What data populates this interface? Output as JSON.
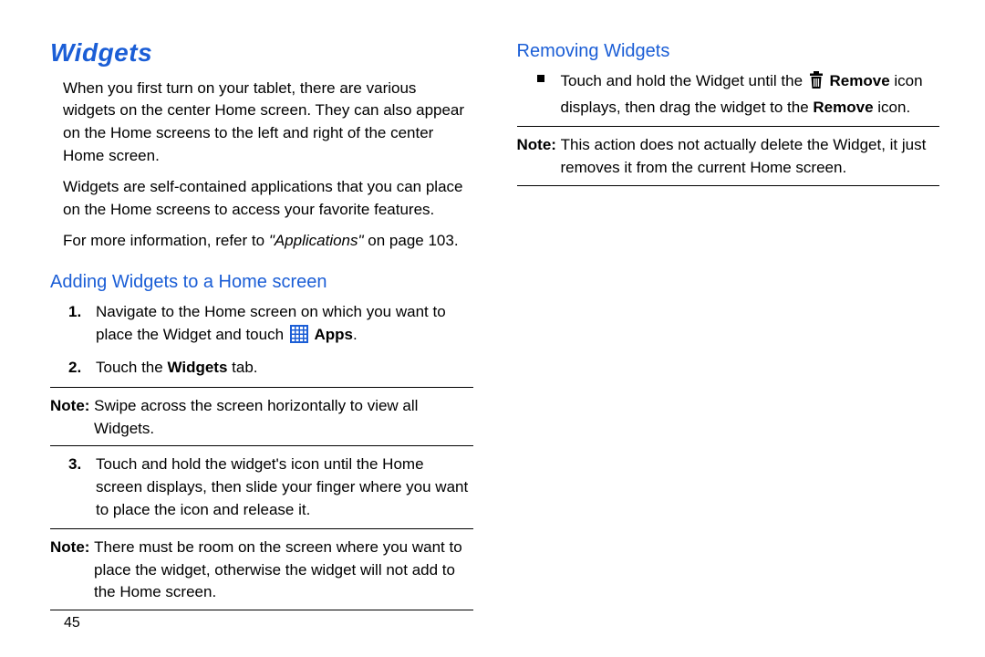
{
  "page_number": "45",
  "left": {
    "title": "Widgets",
    "intro_p1": "When you first turn on your tablet, there are various widgets on the center Home screen. They can also appear on the Home screens to the left and right of the center Home screen.",
    "intro_p2": "Widgets are self-contained applications that you can place on the Home screens to access your favorite features.",
    "ref_prefix": "For more information, refer to ",
    "ref_italic": "\"Applications\"",
    "ref_suffix": " on page 103.",
    "sub1": "Adding Widgets to a Home screen",
    "step1_num": "1.",
    "step1_a": "Navigate to the Home screen on which you want to place the Widget and touch ",
    "step1_b_bold": "Apps",
    "step1_c": ".",
    "step2_num": "2.",
    "step2_a": "Touch the ",
    "step2_b_bold": "Widgets",
    "step2_c": " tab.",
    "note1_label": "Note: ",
    "note1_body": "Swipe across the screen horizontally to view all Widgets.",
    "step3_num": "3.",
    "step3": "Touch and hold the widget's icon until the Home screen displays, then slide your finger where you want to place the icon and release it.",
    "note2_label": "Note: ",
    "note2_body": "There must be room on the screen where you want to place the widget, otherwise the widget will not add to the Home screen."
  },
  "right": {
    "sub": "Removing Widgets",
    "bullet_a": "Touch and hold the Widget until the ",
    "bullet_b_bold": "Remove",
    "bullet_c": " icon displays, then drag the widget to the ",
    "bullet_d_bold": "Remove",
    "bullet_e": " icon.",
    "note_label": "Note: ",
    "note_body": "This action does not actually delete the Widget, it just removes it from the current Home screen."
  }
}
